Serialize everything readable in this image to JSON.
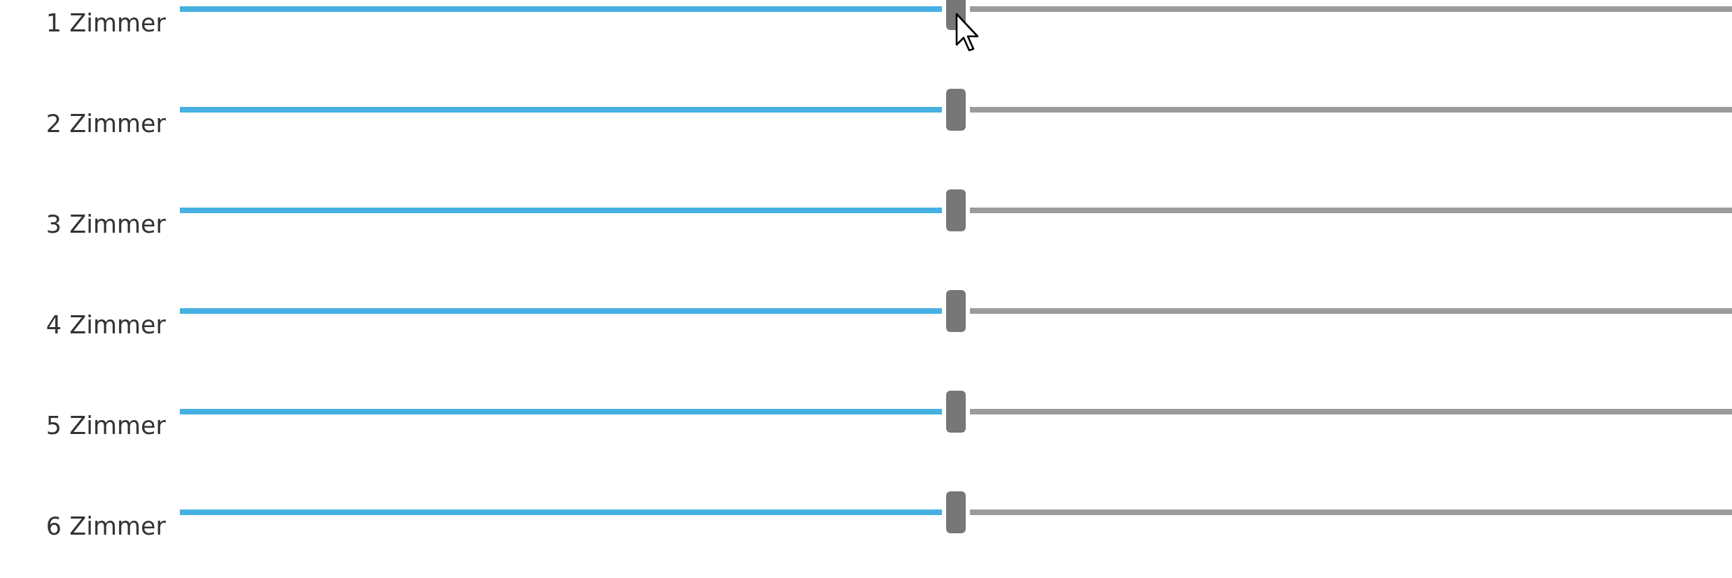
{
  "sliders": [
    {
      "label": "1 Zimmer",
      "level": 0.5
    },
    {
      "label": "2 Zimmer",
      "level": 0.5
    },
    {
      "label": "3 Zimmer",
      "level": 0.5
    },
    {
      "label": "4 Zimmer",
      "level": 0.5
    },
    {
      "label": "5 Zimmer",
      "level": 0.5
    },
    {
      "label": "6 Zimmer",
      "level": 0.5
    }
  ]
}
